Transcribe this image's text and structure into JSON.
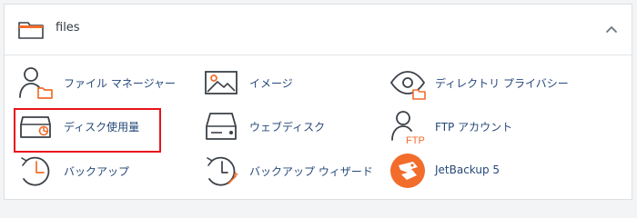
{
  "panel": {
    "title": "files",
    "header_icon": "folder-icon",
    "toggle_icon": "chevron-up-icon"
  },
  "items": [
    {
      "label": "ファイル マネージャー",
      "icon": "file-manager-icon"
    },
    {
      "label": "イメージ",
      "icon": "images-icon"
    },
    {
      "label": "ディレクトリ プライバシー",
      "icon": "directory-privacy-icon"
    },
    {
      "label": "ディスク使用量",
      "icon": "disk-usage-icon",
      "highlighted": true
    },
    {
      "label": "ウェブディスク",
      "icon": "web-disk-icon"
    },
    {
      "label": "FTP アカウント",
      "icon": "ftp-accounts-icon"
    },
    {
      "label": "バックアップ",
      "icon": "backup-icon"
    },
    {
      "label": "バックアップ ウィザード",
      "icon": "backup-wizard-icon"
    },
    {
      "label": "JetBackup 5",
      "icon": "jetbackup-icon"
    }
  ],
  "colors": {
    "label": "#26487a",
    "icon_stroke": "#3b4148",
    "accent_orange": "#f26c2b",
    "highlight_border": "#e8131a",
    "panel_border": "#dcdfe3"
  }
}
